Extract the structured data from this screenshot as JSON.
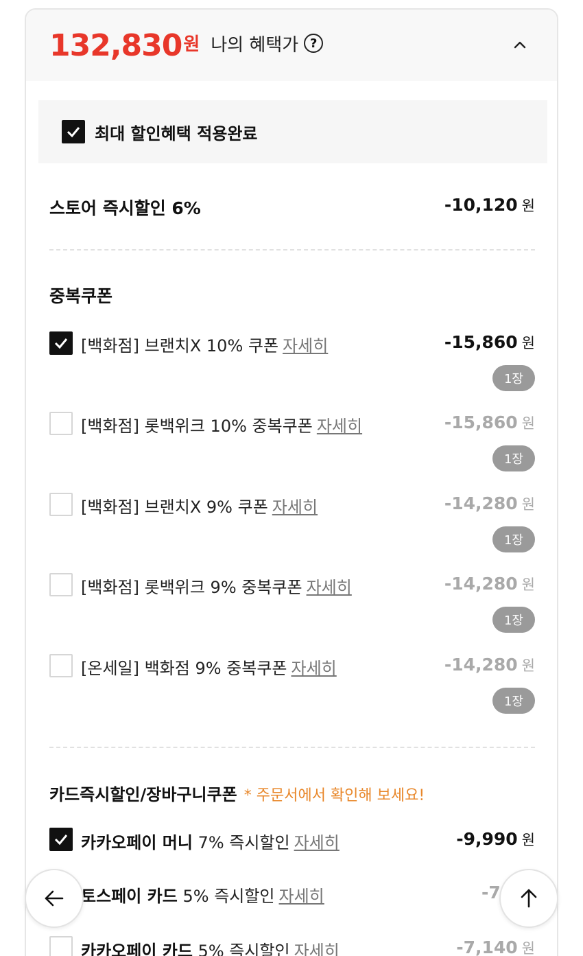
{
  "header": {
    "price": "132,830",
    "price_unit": "원",
    "benefit_label": "나의 혜택가",
    "help_glyph": "?"
  },
  "max_discount": {
    "label": "최대 할인혜택 적용완료",
    "checked": true
  },
  "store_discount": {
    "label": "스토어 즉시할인 6%",
    "amount": "-10,120",
    "unit": "원"
  },
  "coupon_section": {
    "title": "중복쿠폰",
    "detail_label": "자세히",
    "items": [
      {
        "label": "[백화점] 브랜치X 10% 쿠폰",
        "amount": "-15,860",
        "unit": "원",
        "badge": "1장",
        "checked": true
      },
      {
        "label": "[백화점] 롯백위크 10% 중복쿠폰",
        "amount": "-15,860",
        "unit": "원",
        "badge": "1장",
        "checked": false
      },
      {
        "label": "[백화점] 브랜치X 9% 쿠폰",
        "amount": "-14,280",
        "unit": "원",
        "badge": "1장",
        "checked": false
      },
      {
        "label": "[백화점] 롯백위크 9% 중복쿠폰",
        "amount": "-14,280",
        "unit": "원",
        "badge": "1장",
        "checked": false
      },
      {
        "label": "[온세일] 백화점 9% 중복쿠폰",
        "amount": "-14,280",
        "unit": "원",
        "badge": "1장",
        "checked": false
      }
    ]
  },
  "card_section": {
    "title": "카드즉시할인/장바구니쿠폰",
    "note": "* 주문서에서 확인해 보세요!",
    "detail_label": "자세히",
    "items": [
      {
        "name": "카카오페이 머니",
        "desc": "7% 즉시할인",
        "amount": "-9,990",
        "unit": "원",
        "checked": true
      },
      {
        "name": "토스페이 카드",
        "desc": "5% 즉시할인",
        "amount": "-7,14",
        "unit": "",
        "checked": false
      },
      {
        "name": "카카오페이 카드",
        "desc": "5% 즉시할인",
        "amount": "-7,140",
        "unit": "원",
        "checked": false
      }
    ]
  },
  "icons": {
    "check": "check-icon",
    "chevron": "chevron-up-icon",
    "back": "arrow-left-icon",
    "top": "arrow-up-icon"
  },
  "colors": {
    "price": "#e8372a",
    "note": "#e8872a",
    "badge": "#9a9a9a",
    "muted_amount": "#a9a9a9"
  }
}
